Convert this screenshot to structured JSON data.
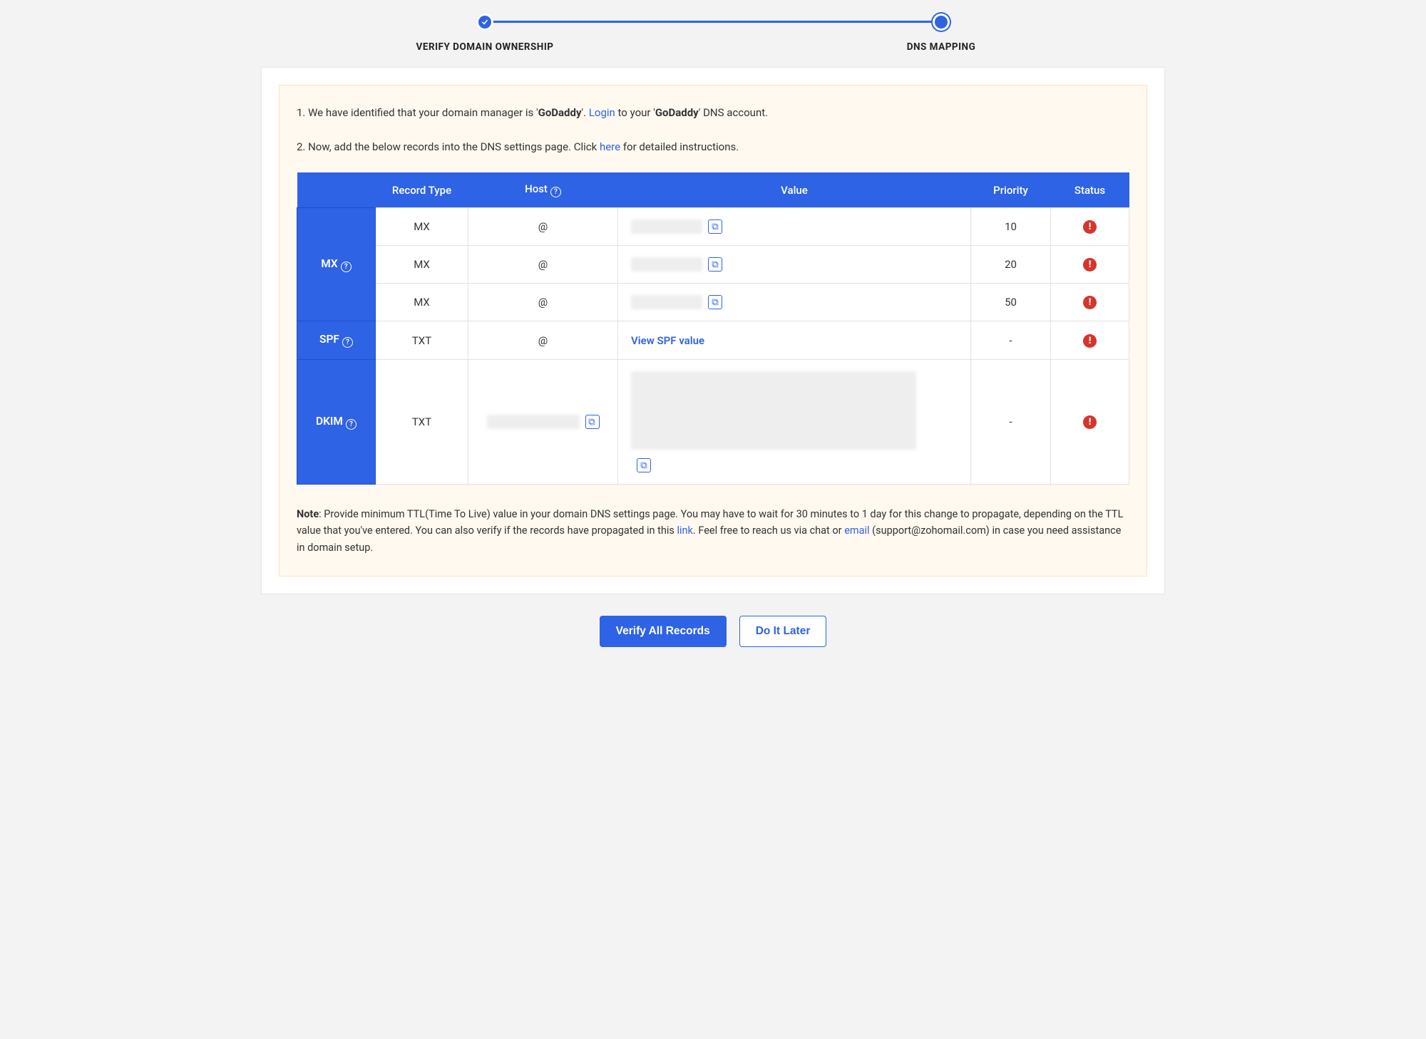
{
  "stepper": {
    "step1": "VERIFY DOMAIN OWNERSHIP",
    "step2": "DNS MAPPING"
  },
  "intro": {
    "line1_prefix": "1. We have identified that your domain manager is '",
    "provider": "GoDaddy",
    "line1_mid": "'. ",
    "login_link": "Login",
    "line1_suffix_a": " to your '",
    "line1_suffix_b": "' DNS account.",
    "line2_prefix": "2. Now, add the below records into the DNS settings page. Click ",
    "here_link": "here",
    "line2_suffix": " for detailed instructions."
  },
  "table": {
    "headers": {
      "blank": "",
      "record_type": "Record Type",
      "host": "Host",
      "value": "Value",
      "priority": "Priority",
      "status": "Status"
    },
    "groups": {
      "mx": "MX",
      "spf": "SPF",
      "dkim": "DKIM"
    },
    "rows": {
      "mx1": {
        "type": "MX",
        "host": "@",
        "priority": "10"
      },
      "mx2": {
        "type": "MX",
        "host": "@",
        "priority": "20"
      },
      "mx3": {
        "type": "MX",
        "host": "@",
        "priority": "50"
      },
      "spf": {
        "type": "TXT",
        "host": "@",
        "value_link": "View SPF value",
        "priority": "-"
      },
      "dkim": {
        "type": "TXT",
        "priority": "-"
      }
    }
  },
  "note": {
    "bold": "Note",
    "text1": ": Provide minimum TTL(Time To Live) value in your domain DNS settings page. You may have to wait for 30 minutes to 1 day for this change to propagate, depending on the TTL value that you've entered. You can also verify if the records have propagated in this ",
    "link1": "link",
    "text2": ". Feel free to reach us via chat or ",
    "link2": "email",
    "text3": " (support@zohomail.com) in case you need assistance in domain setup."
  },
  "actions": {
    "verify": "Verify All Records",
    "later": "Do It Later"
  }
}
